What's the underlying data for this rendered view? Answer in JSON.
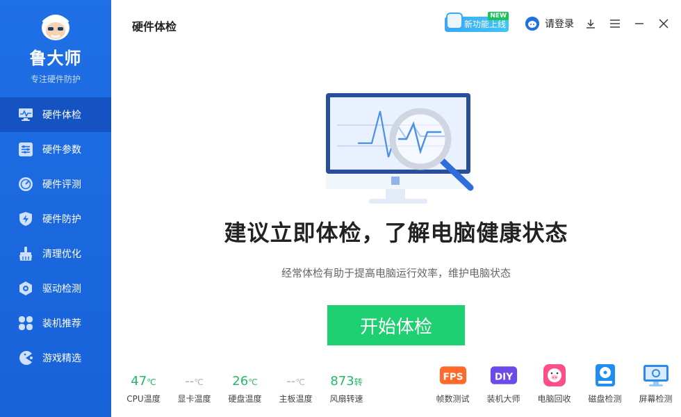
{
  "app": {
    "name": "鲁大师",
    "tagline": "专注硬件防护"
  },
  "sidebar": {
    "items": [
      {
        "label": "硬件体检",
        "icon": "monitor-wave-icon",
        "active": true
      },
      {
        "label": "硬件参数",
        "icon": "sliders-icon"
      },
      {
        "label": "硬件评测",
        "icon": "gauge-icon"
      },
      {
        "label": "硬件防护",
        "icon": "shield-bolt-icon"
      },
      {
        "label": "清理优化",
        "icon": "broom-icon"
      },
      {
        "label": "驱动检测",
        "icon": "gear-hex-icon"
      },
      {
        "label": "装机推荐",
        "icon": "grid-blocks-icon"
      },
      {
        "label": "游戏精选",
        "icon": "pacman-icon"
      }
    ]
  },
  "header": {
    "title": "硬件体检",
    "new_feature_label": "新功能上线",
    "new_tag": "NEW",
    "login_label": "请登录"
  },
  "hero": {
    "headline": "建议立即体检，了解电脑健康状态",
    "subline": "经常体检有助于提高电脑运行效率，维护电脑状态",
    "start_button": "开始体检"
  },
  "stats": [
    {
      "value": "47",
      "unit": "℃",
      "label": "CPU温度",
      "muted": false
    },
    {
      "value": "--",
      "unit": "℃",
      "label": "显卡温度",
      "muted": true
    },
    {
      "value": "26",
      "unit": "℃",
      "label": "硬盘温度",
      "muted": false
    },
    {
      "value": "--",
      "unit": "℃",
      "label": "主板温度",
      "muted": true
    },
    {
      "value": "873",
      "unit": "转",
      "label": "风扇转速",
      "muted": false
    }
  ],
  "tools": [
    {
      "label": "帧数测试",
      "icon": "fps-icon",
      "badge": "FPS"
    },
    {
      "label": "装机大师",
      "icon": "diy-icon",
      "badge": "DIY"
    },
    {
      "label": "电脑回收",
      "icon": "pig-icon"
    },
    {
      "label": "磁盘检测",
      "icon": "disk-icon"
    },
    {
      "label": "屏幕检测",
      "icon": "screen-check-icon"
    }
  ],
  "colors": {
    "sidebar_bg": "#1f6fe6",
    "sidebar_active": "#1552c2",
    "primary_green": "#1ed072",
    "stat_green": "#22b968"
  }
}
